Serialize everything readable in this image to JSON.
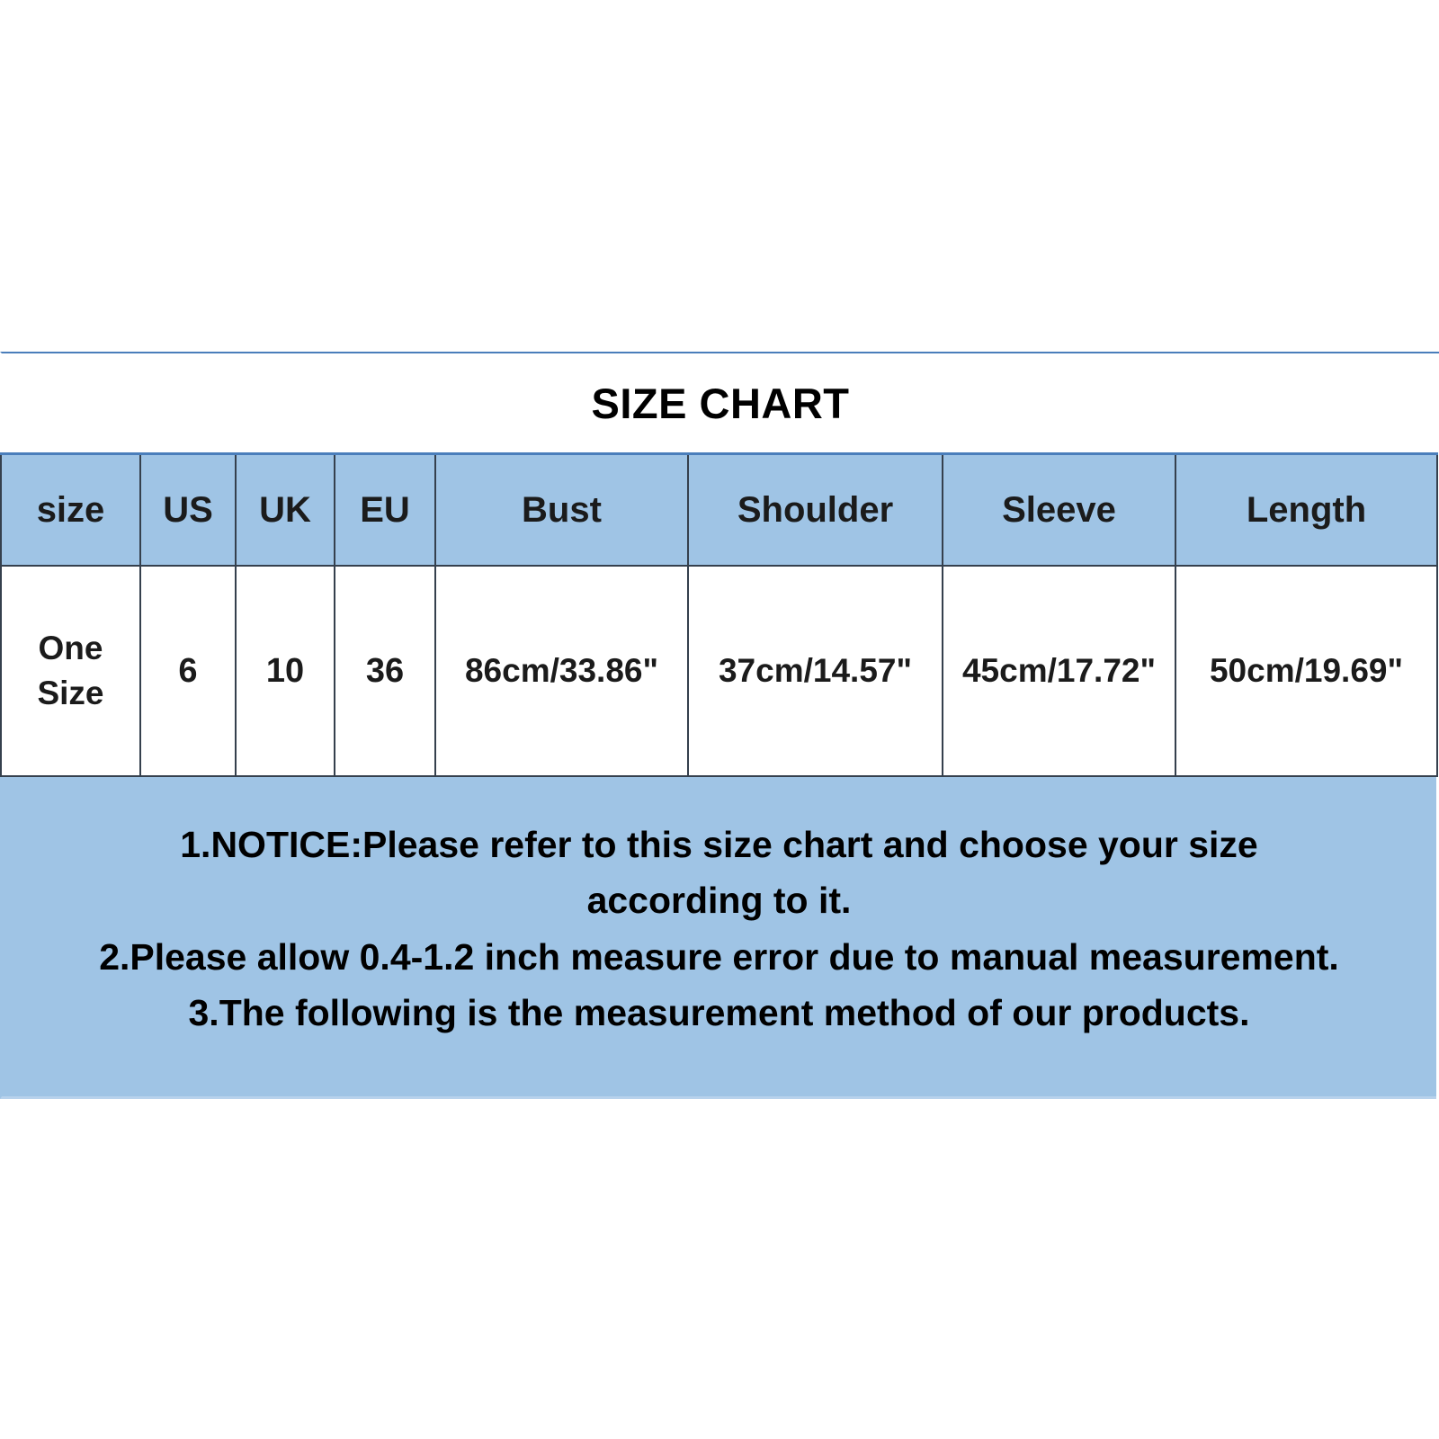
{
  "title": "SIZE CHART",
  "table": {
    "headers": [
      "size",
      "US",
      "UK",
      "EU",
      "Bust",
      "Shoulder",
      "Sleeve",
      "Length"
    ],
    "rows": [
      {
        "size": "One Size",
        "us": "6",
        "uk": "10",
        "eu": "36",
        "bust": "86cm/33.86\"",
        "shoulder": "37cm/14.57\"",
        "sleeve": "45cm/17.72\"",
        "length": "50cm/19.69\""
      }
    ]
  },
  "notice": {
    "line1": "1.NOTICE:Please refer to this size chart and choose your size according to it.",
    "line2": "2.Please allow 0.4-1.2 inch measure error due to manual measurement.",
    "line3": "3.The following is the measurement method of our products."
  },
  "colors": {
    "header_blue": "#9fc4e5",
    "border_dark": "#35404d",
    "border_accent": "#4a7ebb",
    "text": "#1b1b1b",
    "background": "#ffffff"
  }
}
